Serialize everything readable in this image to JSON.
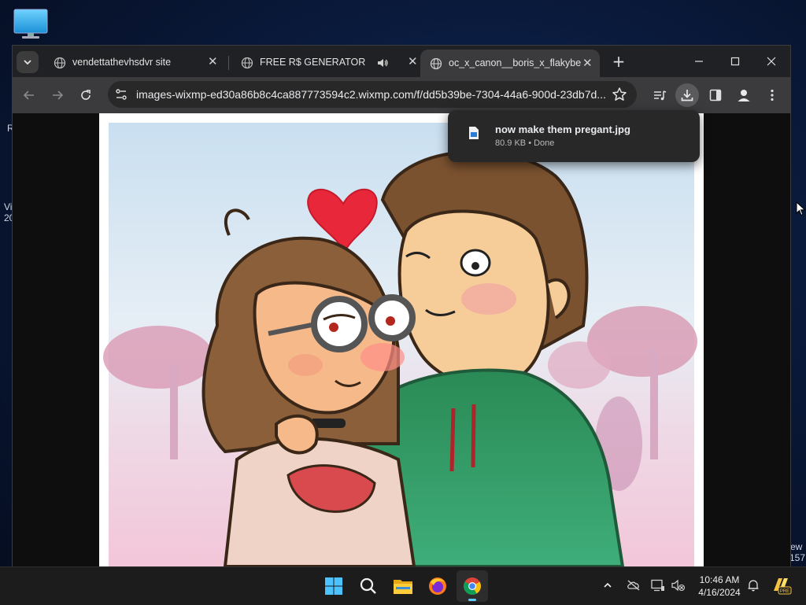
{
  "desktop": {
    "fragments": [
      "R",
      "Vi",
      "20",
      "ew",
      "157"
    ]
  },
  "tabs": [
    {
      "title": "vendettathevhsdvr site",
      "icon": "globe-icon"
    },
    {
      "title": "FREE R$ GENERATOR",
      "icon": "globe-icon",
      "audio": true
    },
    {
      "title": "oc_x_canon__boris_x_flakybea_",
      "icon": "globe-icon",
      "active": true
    }
  ],
  "toolbar": {
    "url": "images-wixmp-ed30a86b8c4ca887773594c2.wixmp.com/f/dd5b39be-7304-44a6-900d-23db7d..."
  },
  "download": {
    "filename": "now make them pregant.jpg",
    "meta": "80.9 KB • Done"
  },
  "clock": {
    "time": "10:46 AM",
    "date": "4/16/2024"
  },
  "taskbar": {
    "apps": [
      "start-icon",
      "search-icon",
      "file-explorer-icon",
      "firefox-icon",
      "chrome-icon"
    ],
    "active_app": "chrome-icon"
  },
  "colors": {
    "accent": "#60cdff",
    "toolbar": "#3b3b3d",
    "tabstrip": "#202124"
  }
}
